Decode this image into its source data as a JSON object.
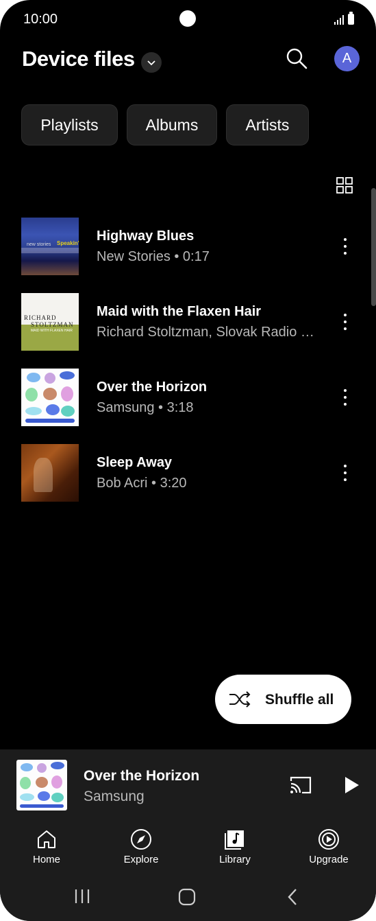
{
  "status_bar": {
    "time": "10:00"
  },
  "header": {
    "title": "Device files",
    "avatar_letter": "A"
  },
  "chips": [
    {
      "label": "Playlists"
    },
    {
      "label": "Albums"
    },
    {
      "label": "Artists"
    }
  ],
  "tracks": [
    {
      "title": "Highway Blues",
      "subtitle": "New Stories • 0:17",
      "art": "blue-album-art",
      "art_text_1": "new stories",
      "art_text_2": "Speakin'"
    },
    {
      "title": "Maid with the Flaxen Hair",
      "subtitle": "Richard Stoltzman, Slovak Radio …",
      "art": "green-album-art",
      "art_text_1": "RICHARD",
      "art_text_2": "STOLTZMAN",
      "art_text_3": "MAID WITH FLAXEN HAIR"
    },
    {
      "title": "Over the Horizon",
      "subtitle": "Samsung • 3:18",
      "art": "cartoon-album-art"
    },
    {
      "title": "Sleep Away",
      "subtitle": "Bob Acri • 3:20",
      "art": "brown-album-art"
    }
  ],
  "shuffle": {
    "label": "Shuffle all",
    "icon": "shuffle-icon"
  },
  "mini_player": {
    "title": "Over the Horizon",
    "subtitle": "Samsung"
  },
  "nav": [
    {
      "label": "Home",
      "icon": "home-icon"
    },
    {
      "label": "Explore",
      "icon": "compass-icon"
    },
    {
      "label": "Library",
      "icon": "library-icon"
    },
    {
      "label": "Upgrade",
      "icon": "upgrade-icon"
    }
  ],
  "colors": {
    "background": "#000000",
    "accent_avatar": "#5a65d8",
    "surface": "#1c1c1c",
    "chip": "#1f1f1f"
  }
}
